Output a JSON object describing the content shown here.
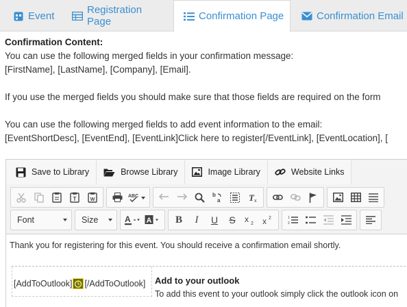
{
  "tabs": [
    {
      "label": "Event",
      "icon": "event-icon",
      "active": false
    },
    {
      "label": "Registration Page",
      "icon": "table-icon",
      "active": false
    },
    {
      "label": "Confirmation Page",
      "icon": "list-icon",
      "active": true
    },
    {
      "label": "Confirmation Email",
      "icon": "envelope-icon",
      "active": false
    }
  ],
  "content": {
    "heading": "Confirmation Content:",
    "line1": "You can use the following merged fields in your confirmation message:",
    "line2": "[FirstName], [LastName], [Company], [Email].",
    "line3": "If you use the merged fields you should make sure that those fields are required on the form",
    "line4": "You can use the following merged fields to add event information to the email:",
    "line5": "[EventShortDesc], [EventEnd], [EventLink]Click here to register[/EventLink], [EventLocation], [",
    "line5_note": ""
  },
  "library_toolbar": {
    "save": "Save to Library",
    "browse": "Browse Library",
    "image": "Image Library",
    "links": "Website Links"
  },
  "format_toolbar": {
    "font_label": "Font",
    "size_label": "Size"
  },
  "editor_content": {
    "intro": "Thank you for registering for this event. You should receive a confirmation email shortly.",
    "outlook_open": "[AddToOutlook]",
    "outlook_close": "[/AddToOutlook]",
    "outlook_title": "Add to your outlook",
    "outlook_desc": "To add this event to your outlook simply click the outlook icon on"
  },
  "colors": {
    "tab_text": "#3a8fd0",
    "tab_bar": "#ececec",
    "outlook_icon": "#6b6b12"
  }
}
